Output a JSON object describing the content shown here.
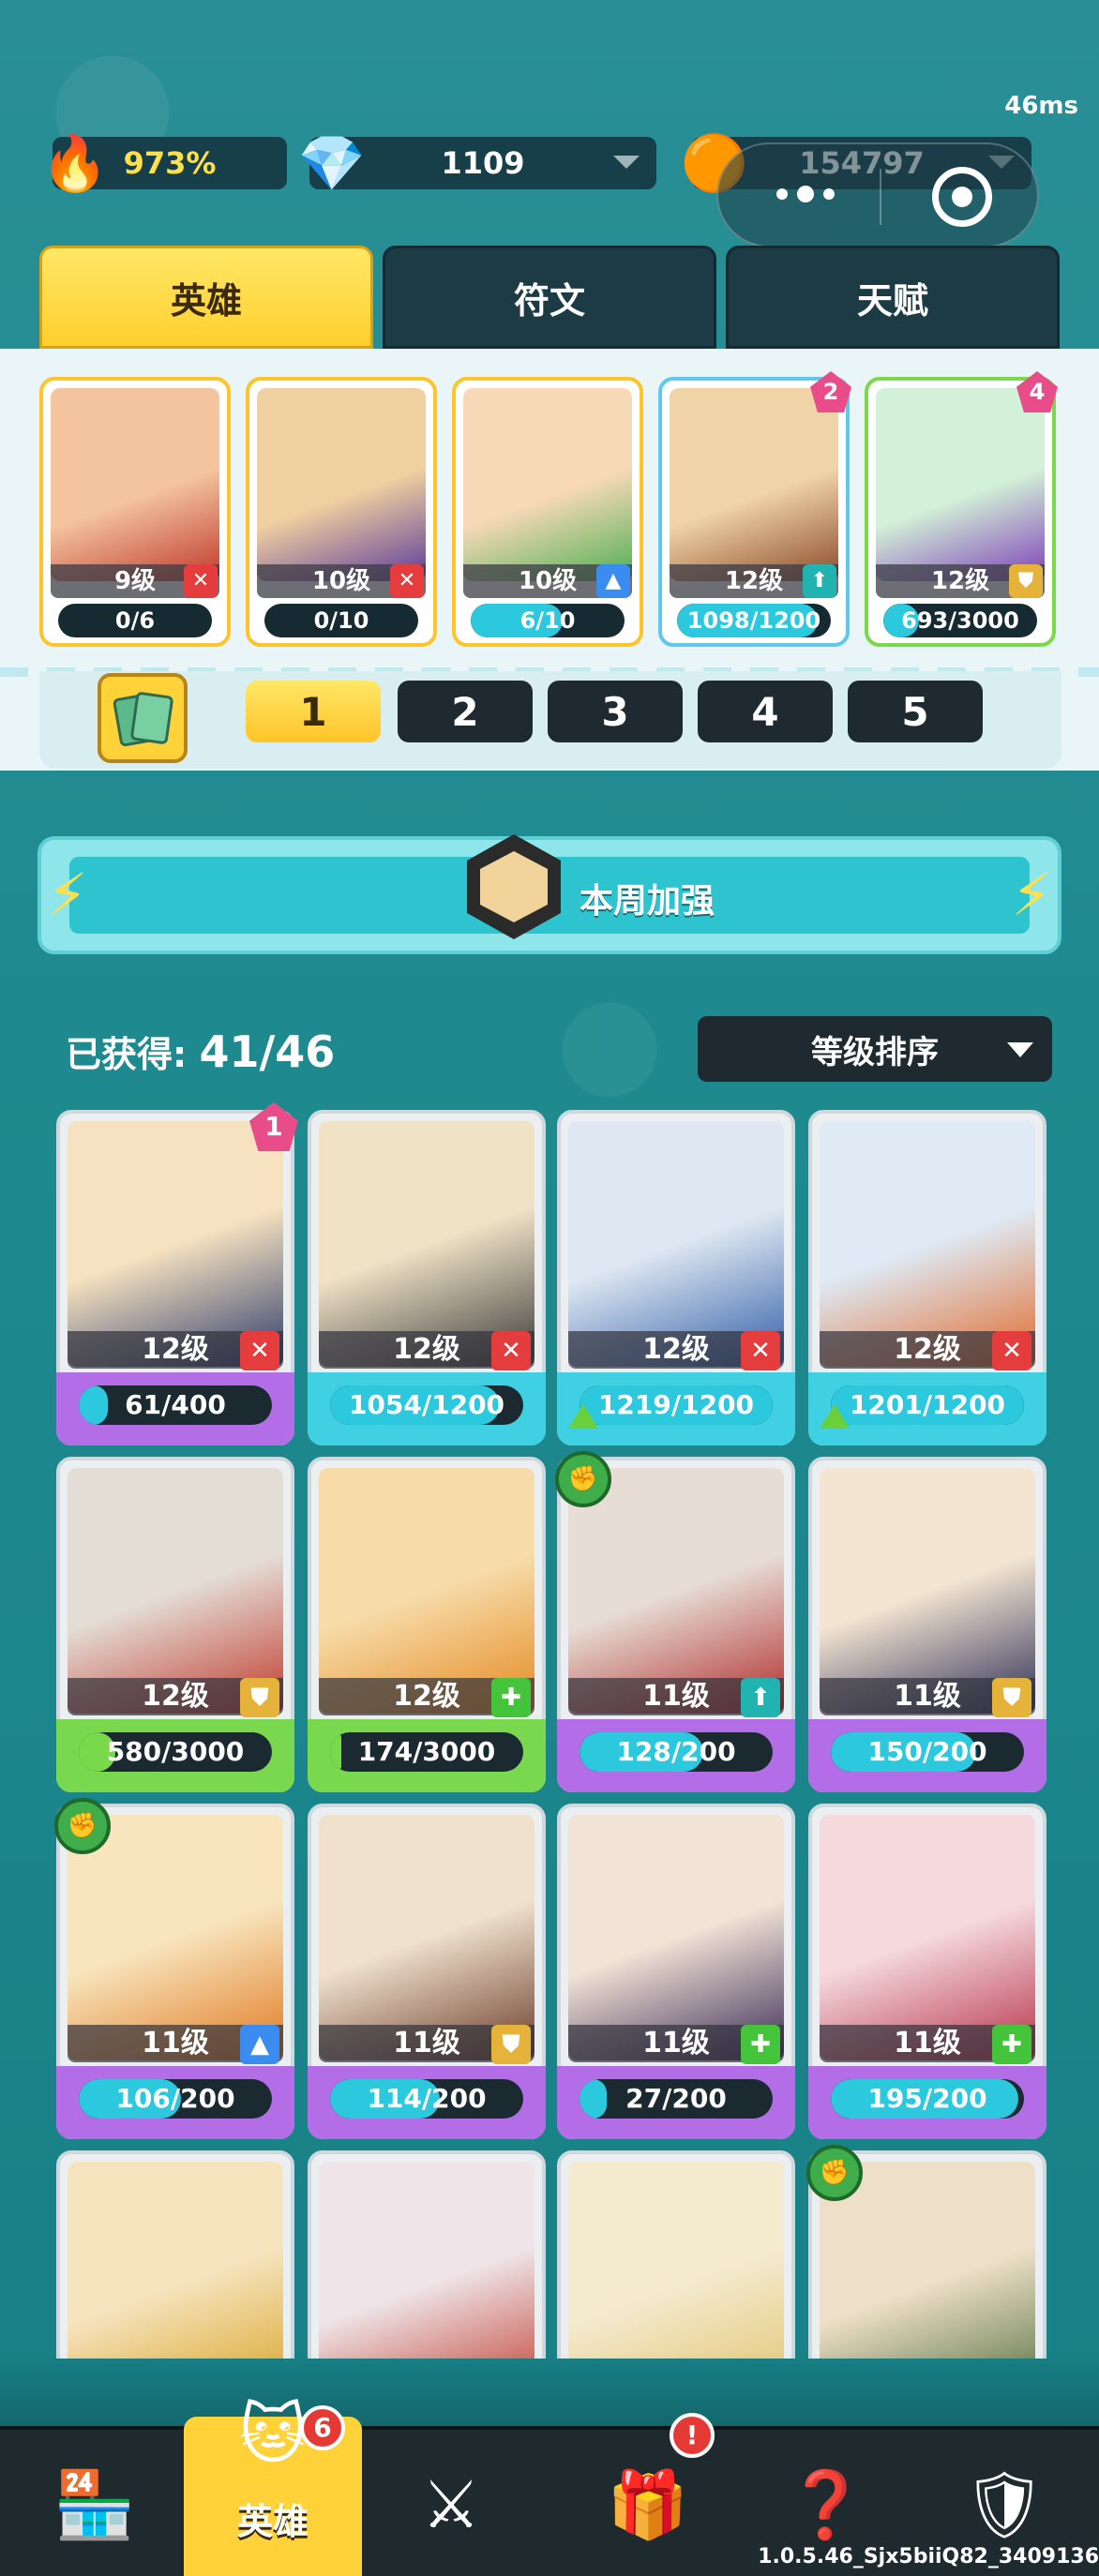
{
  "ping": "46ms",
  "resources": {
    "fire": {
      "value": "973%",
      "icon": "flame-icon"
    },
    "gems": {
      "value": "1109",
      "icon": "diamond-icon"
    },
    "coins": {
      "value": "154797",
      "icon": "paw-coin-icon"
    }
  },
  "tabs": [
    "英雄",
    "符文",
    "天赋"
  ],
  "team_cards": [
    {
      "level": "9级",
      "progress": "0/6",
      "progress_frac": 0.0,
      "role": "sword",
      "art": [
        "#f4c4a0",
        "#c0392b"
      ]
    },
    {
      "level": "10级",
      "progress": "0/10",
      "progress_frac": 0.0,
      "role": "sword",
      "art": [
        "#f0d0a0",
        "#5b3a9b"
      ]
    },
    {
      "level": "10级",
      "progress": "6/10",
      "progress_frac": 0.6,
      "role": "water",
      "art": [
        "#f7d9b8",
        "#4caf50"
      ]
    },
    {
      "level": "12级",
      "progress": "1098/1200",
      "progress_frac": 0.915,
      "role": "arrow",
      "badge": "2",
      "art": [
        "#f1d3a8",
        "#8a4b2a"
      ]
    },
    {
      "level": "12级",
      "progress": "693/3000",
      "progress_frac": 0.231,
      "role": "shield",
      "badge": "4",
      "art": [
        "#d3f0d8",
        "#7d3fb8"
      ]
    }
  ],
  "team_numbers": [
    "1",
    "2",
    "3",
    "4",
    "5"
  ],
  "weekly_buff": "本周加强",
  "obtained": {
    "label": "已获得:",
    "count": "41/46"
  },
  "sort_label": "等级排序",
  "heroes": [
    {
      "level": "12级",
      "progress": "61/400",
      "frac": 0.15,
      "role": "sword",
      "rarity": "purple",
      "badge": "1",
      "art": [
        "#f6e2c0",
        "#2b3a6b"
      ]
    },
    {
      "level": "12级",
      "progress": "1054/1200",
      "frac": 0.88,
      "role": "sword",
      "rarity": "cyan",
      "art": [
        "#efe2c5",
        "#3a3a3a"
      ]
    },
    {
      "level": "12级",
      "progress": "1219/1200",
      "frac": 1.0,
      "role": "sword",
      "rarity": "cyan",
      "up": true,
      "art": [
        "#dfe8f2",
        "#2f5da8"
      ]
    },
    {
      "level": "12级",
      "progress": "1201/1200",
      "frac": 1.0,
      "role": "sword",
      "rarity": "cyan",
      "up": true,
      "art": [
        "#dfeaf5",
        "#e06a2b"
      ]
    },
    {
      "level": "12级",
      "progress": "580/3000",
      "frac": 0.19,
      "role": "shield",
      "rarity": "green",
      "art": [
        "#e4ddd6",
        "#c0392b"
      ]
    },
    {
      "level": "12级",
      "progress": "174/3000",
      "frac": 0.06,
      "role": "heal",
      "rarity": "green",
      "art": [
        "#f7dcaa",
        "#e5891f"
      ]
    },
    {
      "level": "11级",
      "progress": "128/200",
      "frac": 0.64,
      "role": "arrow",
      "rarity": "purple",
      "fist": true,
      "art": [
        "#e7ddd5",
        "#b02a2a"
      ]
    },
    {
      "level": "11级",
      "progress": "150/200",
      "frac": 0.75,
      "role": "shield",
      "rarity": "purple",
      "art": [
        "#f3e5d2",
        "#2c2e55"
      ]
    },
    {
      "level": "11级",
      "progress": "106/200",
      "frac": 0.53,
      "role": "water",
      "rarity": "purple",
      "fist": true,
      "art": [
        "#f8e4bd",
        "#e07a1f"
      ]
    },
    {
      "level": "11级",
      "progress": "114/200",
      "frac": 0.57,
      "role": "shield",
      "rarity": "purple",
      "art": [
        "#efe1cc",
        "#6b3b2a"
      ]
    },
    {
      "level": "11级",
      "progress": "27/200",
      "frac": 0.14,
      "role": "heal",
      "rarity": "purple",
      "art": [
        "#f1e3d6",
        "#3a2a55"
      ]
    },
    {
      "level": "11级",
      "progress": "195/200",
      "frac": 0.97,
      "role": "heal",
      "rarity": "purple",
      "art": [
        "#f5d9dc",
        "#b8324a"
      ]
    },
    {
      "level": "",
      "progress": "",
      "frac": 0,
      "role": "",
      "rarity": "purple",
      "art": [
        "#f6e4bf",
        "#d9a21f"
      ]
    },
    {
      "level": "",
      "progress": "",
      "frac": 0,
      "role": "",
      "rarity": "purple",
      "art": [
        "#efe5e8",
        "#c0392b"
      ]
    },
    {
      "level": "",
      "progress": "",
      "frac": 0,
      "role": "",
      "rarity": "purple",
      "art": [
        "#f4ead0",
        "#e2c46a"
      ]
    },
    {
      "level": "",
      "progress": "",
      "frac": 0,
      "role": "",
      "rarity": "purple",
      "fist": true,
      "art": [
        "#eee0c8",
        "#4f6b3a"
      ]
    }
  ],
  "nav": [
    {
      "name": "shop",
      "icon": "shop-icon"
    },
    {
      "name": "heroes",
      "label": "英雄",
      "icon": "hero-cat-icon",
      "badge": "6",
      "active": true
    },
    {
      "name": "battle",
      "icon": "crossed-swords-icon"
    },
    {
      "name": "gift",
      "icon": "gift-icon",
      "badge": "!"
    },
    {
      "name": "quests",
      "icon": "question-cards-icon"
    },
    {
      "name": "guild",
      "icon": "banner-icon"
    }
  ],
  "version": "1.0.5.46_Sjx5biiQ82_3409136"
}
